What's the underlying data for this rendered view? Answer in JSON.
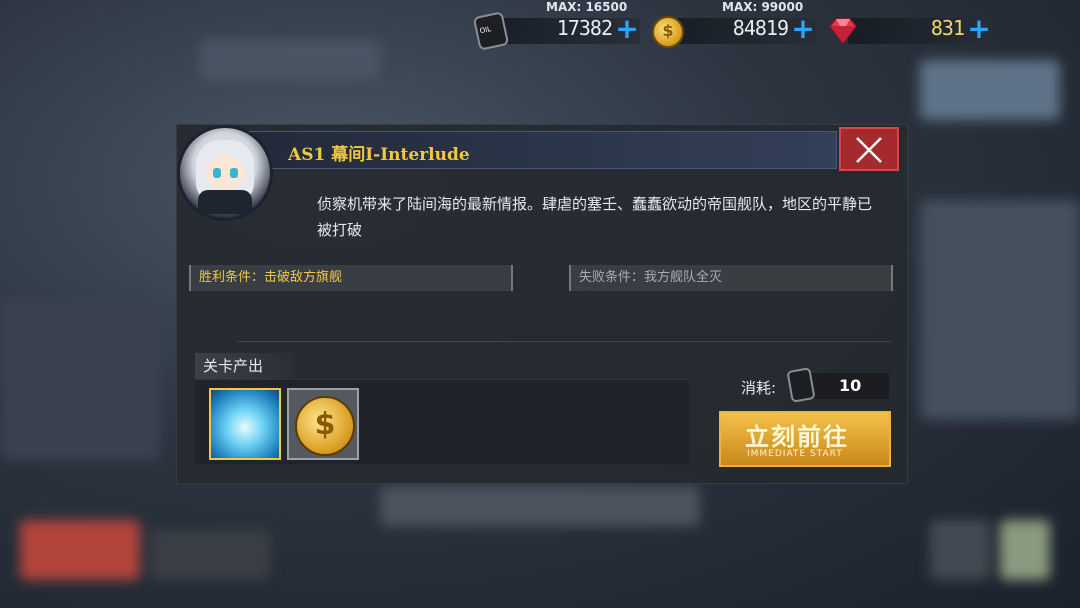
{
  "resources": {
    "oil": {
      "max_label": "MAX: 16500",
      "value": "17382",
      "icon": "oil-barrel-icon"
    },
    "gold": {
      "max_label": "MAX: 99000",
      "value": "84819",
      "icon": "gold-coin-icon"
    },
    "gems": {
      "value": "831",
      "icon": "gem-icon"
    }
  },
  "stage": {
    "title": "AS1 幕间I-Interlude",
    "description": "侦察机带来了陆间海的最新情报。肆虐的塞壬、蠢蠢欲动的帝国舰队，地区的平静已被打破",
    "victory": "胜利条件：击破敌方旗舰",
    "defeat": "失败条件：我方舰队全灭"
  },
  "drops": {
    "label": "关卡产出",
    "items": [
      "cube-icon",
      "gold-coin-icon"
    ]
  },
  "cost": {
    "label": "消耗:",
    "value": "10"
  },
  "start_button": {
    "label": "立刻前往",
    "sub": "IMMEDIATE START"
  },
  "colors": {
    "accent": "#f2c640",
    "plus": "#2aa6ff",
    "close": "#a52a2e"
  }
}
